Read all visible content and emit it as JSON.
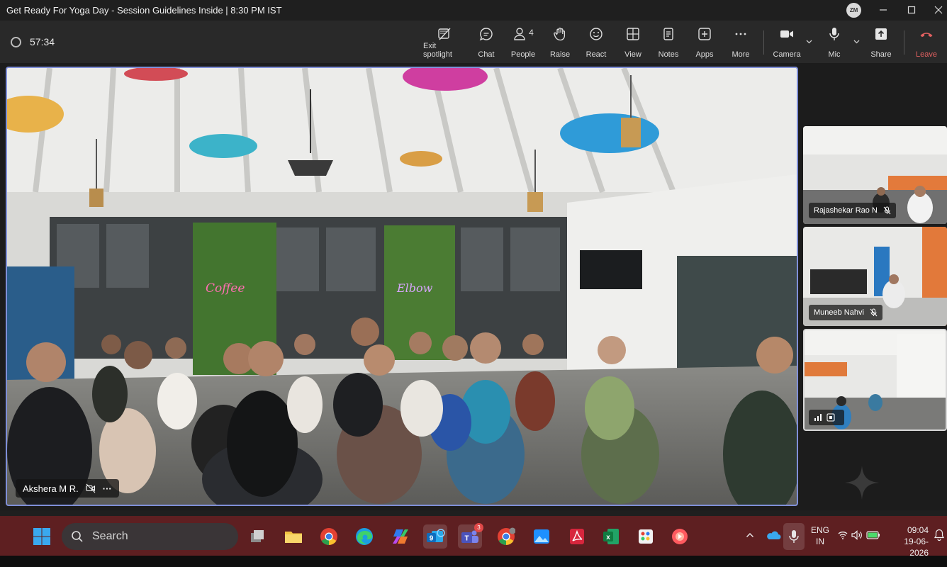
{
  "window": {
    "title": "Get Ready For Yoga Day - Session Guidelines Inside | 8:30 PM IST",
    "avatar_initials": "ZM"
  },
  "meeting": {
    "timer": "57:34",
    "toolbar": [
      {
        "label": "Exit spotlight",
        "icon": "exit-spotlight-icon"
      },
      {
        "label": "Chat",
        "icon": "chat-icon"
      },
      {
        "label": "People",
        "icon": "people-icon",
        "count": "4"
      },
      {
        "label": "Raise",
        "icon": "raise-hand-icon"
      },
      {
        "label": "React",
        "icon": "react-icon"
      },
      {
        "label": "View",
        "icon": "view-icon"
      },
      {
        "label": "Notes",
        "icon": "notes-icon"
      },
      {
        "label": "Apps",
        "icon": "apps-icon"
      },
      {
        "label": "More",
        "icon": "more-icon"
      },
      {
        "label": "Camera",
        "icon": "camera-icon"
      },
      {
        "label": "Mic",
        "icon": "mic-icon"
      },
      {
        "label": "Share",
        "icon": "share-icon"
      },
      {
        "label": "Leave",
        "icon": "leave-icon"
      }
    ]
  },
  "spotlight": {
    "participant": "Akshera M R.",
    "mic_state": "muted",
    "more_label": "···"
  },
  "participants": [
    {
      "name": "Rajashekar Rao N",
      "mic_state": "muted"
    },
    {
      "name": "Muneeb Nahvi",
      "mic_state": "muted"
    },
    {
      "name": "",
      "mic_state": "speaking"
    }
  ],
  "taskbar": {
    "search_placeholder": "Search",
    "language": "ENG",
    "region": "IN",
    "time": "09:04",
    "date": "19-06-2026",
    "teams_badge": "3",
    "apps": [
      "task-view-icon",
      "file-explorer-icon",
      "chrome-icon",
      "edge-icon",
      "copilot-icon",
      "outlook-icon",
      "teams-icon",
      "chrome-profile-icon",
      "photos-icon",
      "acrobat-icon",
      "excel-icon",
      "paint-icon",
      "vlc-icon"
    ]
  },
  "colors": {
    "taskbar_bg": "#5e1f21",
    "spotlight_border": "#7f8fd8",
    "leave_red": "#e06060"
  }
}
